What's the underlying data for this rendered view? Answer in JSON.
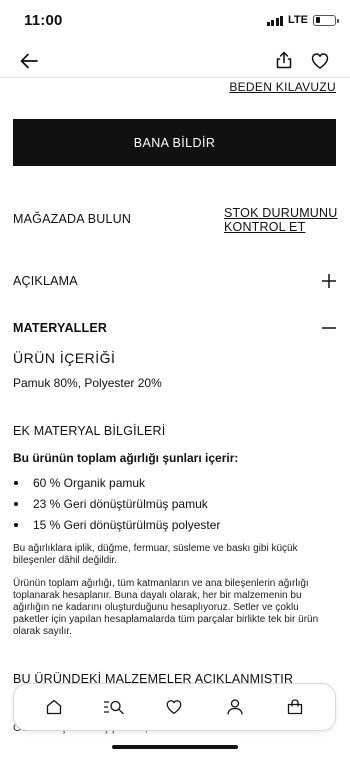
{
  "status_bar": {
    "time": "11:00",
    "network": "LTE",
    "battery_level": 0.2
  },
  "nav": {
    "back_icon": "arrow-left-icon",
    "share_icon": "share-icon",
    "favorite_icon": "heart-icon"
  },
  "size_guide": "BEDEN KILAVUZU",
  "notify_button": "BANA BİLDİR",
  "store": {
    "label": "MAĞAZADA BULUN",
    "stock_link": "STOK DURUMUNU KONTROL ET"
  },
  "description": {
    "label": "AÇIKLAMA",
    "icon": "plus-icon"
  },
  "materials": {
    "label": "MATERYALLER",
    "icon": "minus-icon",
    "content_title": "ÜRÜN İÇERİĞİ",
    "content_value": "Pamuk 80%, Polyester 20%",
    "extra_title": "EK MATERYAL BİLGİLERİ",
    "weight_heading": "Bu ürünün toplam ağırlığı şunları içerir:",
    "weight_items": [
      "60 % Organik pamuk",
      "23 % Geri dönüştürülmüş pamuk",
      "15 % Geri dönüştürülmüş polyester"
    ],
    "note_1": "Bu ağırlıklara iplik, düğme, fermuar, süsleme ve baskı gibi küçük bileşenler dâhil değildir.",
    "note_2": "Ürünün toplam ağırlığı, tüm katmanların ve ana bileşenlerin ağırlığı toplanarak hesaplanır. Buna dayalı olarak, her bir malzemenin bu ağırlığın ne kadarını oluşturduğunu hesaplıyoruz. Setler ve çoklu paketler için yapılan hesaplamalarda tüm parçalar birlikte tek bir ürün olarak sayılır.",
    "partial_heading": "BU ÜRÜNDEKİ MALZEMELER AÇIKLANMIŞTIR",
    "partial_text": "Geri dönüştürülmüş pamuk, üretimdeki tekstil"
  },
  "tab_bar": {
    "tabs": [
      {
        "name": "home",
        "icon": "home-icon"
      },
      {
        "name": "search",
        "icon": "search-menu-icon"
      },
      {
        "name": "favorites",
        "icon": "heart-icon"
      },
      {
        "name": "account",
        "icon": "user-icon"
      },
      {
        "name": "bag",
        "icon": "shopping-bag-icon"
      }
    ]
  }
}
